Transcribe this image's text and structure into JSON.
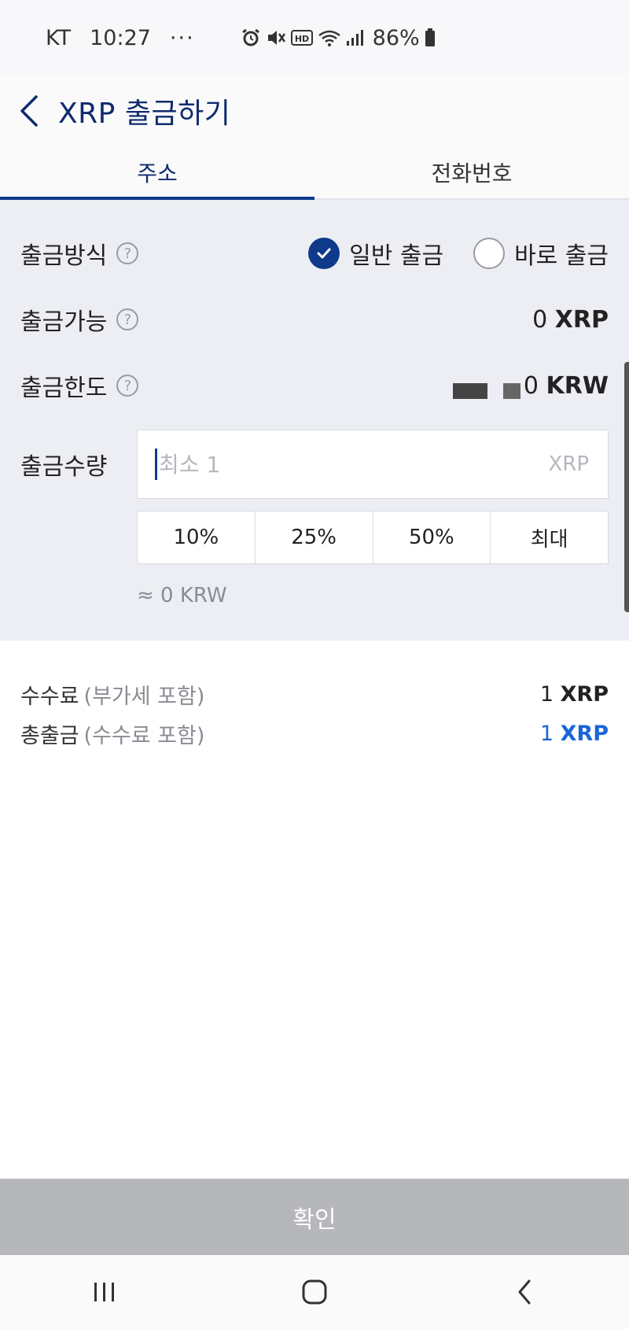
{
  "status_bar": {
    "carrier": "KT",
    "time": "10:27",
    "more": "···",
    "battery_pct": "86%",
    "icons": [
      "alarm-icon",
      "mute-icon",
      "hd-icon",
      "wifi-icon",
      "signal-icon",
      "battery-icon"
    ]
  },
  "header": {
    "title": "XRP 출금하기"
  },
  "tabs": [
    {
      "label": "주소",
      "active": true
    },
    {
      "label": "전화번호",
      "active": false
    }
  ],
  "form": {
    "method": {
      "label": "출금방식",
      "options": [
        {
          "label": "일반 출금",
          "checked": true
        },
        {
          "label": "바로 출금",
          "checked": false
        }
      ]
    },
    "available": {
      "label": "출금가능",
      "value": "0",
      "unit": "XRP"
    },
    "limit": {
      "label": "출금한도",
      "value_visible": "0",
      "unit": "KRW"
    },
    "amount": {
      "label": "출금수량",
      "placeholder": "최소 1",
      "unit": "XRP",
      "quick_buttons": [
        "10%",
        "25%",
        "50%",
        "최대"
      ],
      "approx": "≈ 0 KRW"
    }
  },
  "summary": {
    "fee": {
      "label": "수수료",
      "sub": "(부가세 포함)",
      "value": "1",
      "unit": "XRP"
    },
    "total": {
      "label": "총출금",
      "sub": "(수수료 포함)",
      "value": "1",
      "unit": "XRP"
    }
  },
  "confirm_label": "확인",
  "colors": {
    "accent": "#0f3a8a",
    "title": "#0f2b6e",
    "total_value": "#1a66d9",
    "panel_bg": "#eceef3",
    "confirm_disabled": "#b6b7ba"
  },
  "nav_bar": [
    "recent-apps-icon",
    "home-icon",
    "back-icon"
  ]
}
